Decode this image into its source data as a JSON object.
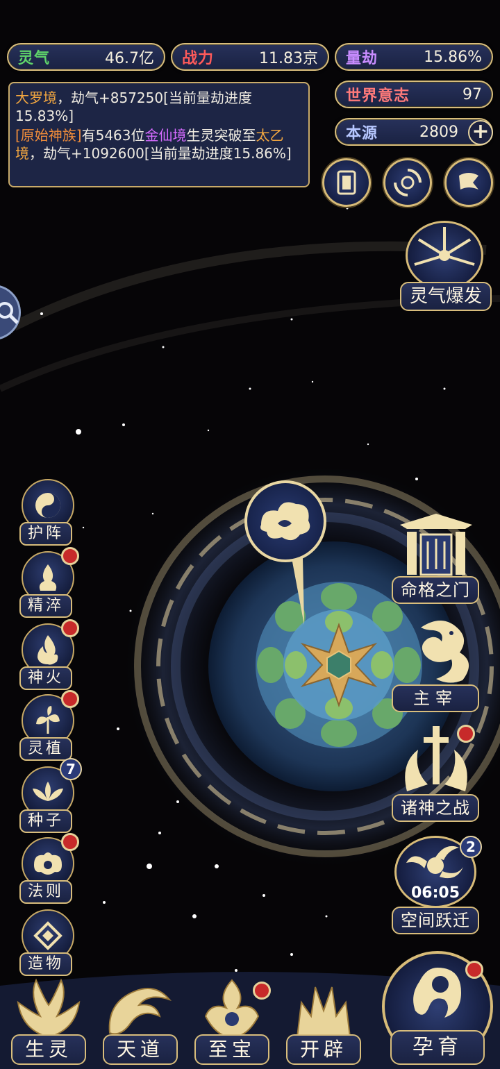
{
  "stats": {
    "lingqi": {
      "label": "灵气",
      "value": "46.7亿",
      "color": "#5fd36a"
    },
    "zhanli": {
      "label": "战力",
      "value": "11.83京",
      "color": "#ff5a5a"
    },
    "liangjie": {
      "label": "量劫",
      "value": "15.86%",
      "color": "#c88cff"
    },
    "world_will": {
      "label": "世界意志",
      "value": "97",
      "color": "#ff7a7a"
    },
    "benyuan": {
      "label": "本源",
      "value": "2809",
      "color": "#b6c7ff",
      "plus_icon": "plus-icon"
    }
  },
  "log": {
    "line1": {
      "realm": "大罗境",
      "text": "，劫气+857250[当前量劫进度15.83%]"
    },
    "line2": {
      "tribe": "[原始神族]",
      "text_a": "有5463位",
      "realm_a": "金仙境",
      "text_b": "生灵突破至",
      "realm_b": "太乙境",
      "text_c": "，劫气+1092600[当前量劫进度15.86%]"
    }
  },
  "top_icons": [
    "card-icon",
    "swirl-icon",
    "flag-icon"
  ],
  "burst": {
    "label": "灵气爆发"
  },
  "left_menu": [
    {
      "label": "护阵",
      "icon": "yinyang-icon",
      "red_dot": false
    },
    {
      "label": "精淬",
      "icon": "flame-figure-icon",
      "red_dot": true
    },
    {
      "label": "神火",
      "icon": "fire-icon",
      "red_dot": true
    },
    {
      "label": "灵植",
      "icon": "plant-icon",
      "red_dot": true
    },
    {
      "label": "种子",
      "icon": "lotus-icon",
      "badge": "7"
    },
    {
      "label": "法则",
      "icon": "law-icon",
      "red_dot": true
    },
    {
      "label": "造物",
      "icon": "diamond-icon",
      "red_dot": false
    }
  ],
  "right_menu": [
    {
      "label": "命格之门",
      "icon": "gate-icon"
    },
    {
      "label": "主宰",
      "icon": "dragon-icon"
    },
    {
      "label": "诸神之战",
      "icon": "sword-icon",
      "red_dot": true
    },
    {
      "label": "空间跃迁",
      "icon": "portal-icon",
      "badge": "2",
      "timer": "06:05"
    }
  ],
  "bottom_nav": [
    {
      "label": "生灵",
      "icon": "phoenix-icon"
    },
    {
      "label": "天道",
      "icon": "wave-icon"
    },
    {
      "label": "至宝",
      "icon": "treasure-icon",
      "red_dot": true
    },
    {
      "label": "开辟",
      "icon": "flame-crown-icon"
    },
    {
      "label": "孕育",
      "icon": "embryo-icon",
      "red_dot": true
    }
  ]
}
